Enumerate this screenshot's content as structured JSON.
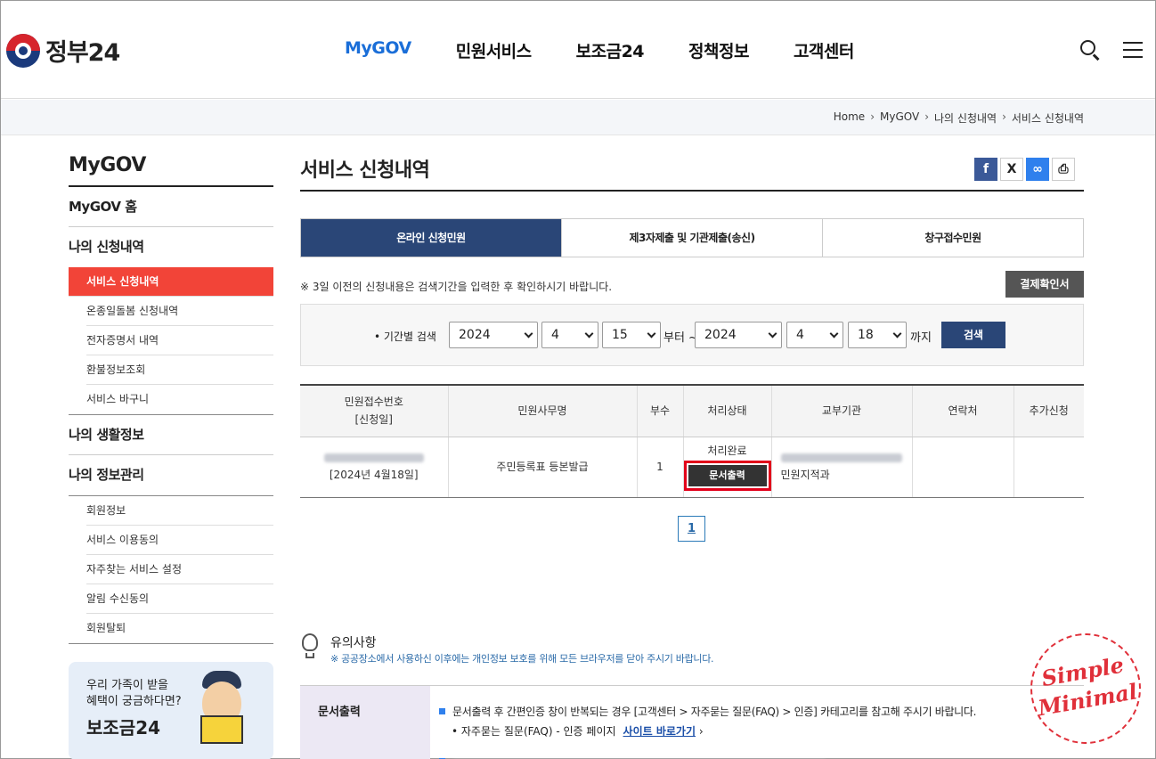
{
  "header": {
    "logo_text": "정부24",
    "nav": [
      "MyGOV",
      "민원서비스",
      "보조금24",
      "정책정보",
      "고객센터"
    ]
  },
  "breadcrumb": [
    "Home",
    "MyGOV",
    "나의 신청내역",
    "서비스 신청내역"
  ],
  "sidebar": {
    "title": "MyGOV",
    "home": "MyGOV 홈",
    "group1": "나의 신청내역",
    "group1_items": [
      "서비스 신청내역",
      "온종일돌봄 신청내역",
      "전자증명서 내역",
      "환불정보조회",
      "서비스 바구니"
    ],
    "group2": "나의 생활정보",
    "group3": "나의 정보관리",
    "group3_items": [
      "회원정보",
      "서비스 이용동의",
      "자주찾는 서비스 설정",
      "알림 수신동의",
      "회원탈퇴"
    ],
    "banner_line1": "우리 가족이 받을",
    "banner_line2": "혜택이 궁금하다면?",
    "banner_title": "보조금24"
  },
  "main": {
    "title": "서비스 신청내역",
    "tabs": [
      "온라인 신청민원",
      "제3자제출 및 기관제출(송신)",
      "창구접수민원"
    ],
    "notice": "※ 3일 이전의 신청내용은 검색기간을 입력한 후 확인하시기 바랍니다.",
    "pay_button": "결제확인서",
    "search": {
      "label": "• 기간별 검색",
      "from_year": "2024",
      "from_month": "4",
      "from_day": "15",
      "from_word": "부터 ~",
      "to_year": "2024",
      "to_month": "4",
      "to_day": "18",
      "to_word": "까지",
      "button": "검색"
    },
    "table": {
      "headers": [
        "민원접수번호",
        "[신청일]",
        "민원사무명",
        "부수",
        "처리상태",
        "교부기관",
        "연락처",
        "추가신청"
      ],
      "row": {
        "date": "[2024년 4월18일]",
        "name": "주민등록표 등본발급",
        "count": "1",
        "status": "처리완료",
        "print_button": "문서출력",
        "agency": "민원지적과"
      }
    },
    "page": "1",
    "caution_title": "유의사항",
    "caution_desc": "※ 공공장소에서 사용하신 이후에는 개인정보 보호를 위해 모든 브라우저를 닫아 주시기 바랍니다.",
    "info": {
      "head": "문서출력",
      "line1": "문서출력 후 간편인증 창이 반복되는 경우 [고객센터 > 자주묻는 질문(FAQ) > 인증] 카테고리를 참고해 주시기 바랍니다.",
      "line2": "• 자주묻는 질문(FAQ) - 인증 페이지",
      "link": "사이트 바로가기"
    }
  },
  "stamp": {
    "line1": "Simple",
    "line2": "Minimal"
  }
}
